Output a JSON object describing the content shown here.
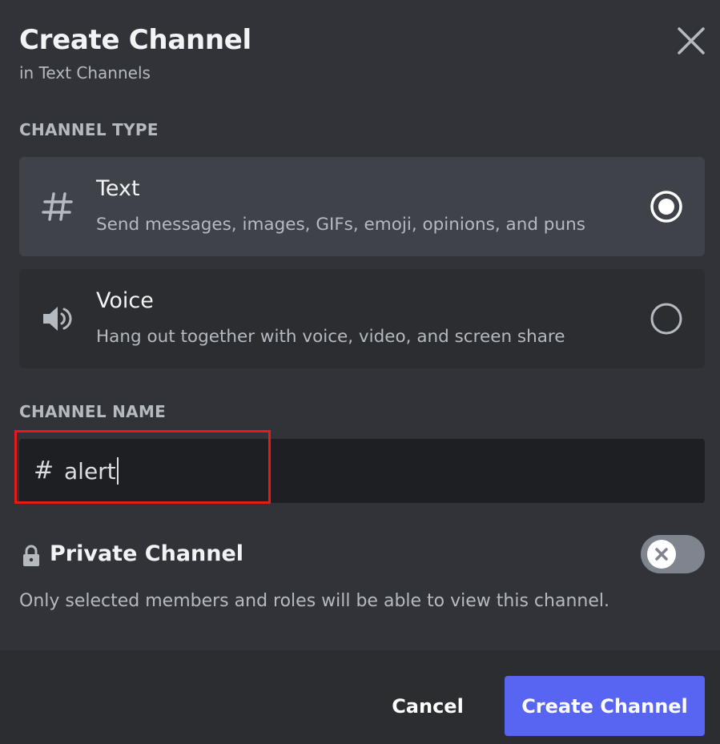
{
  "dialog": {
    "title": "Create Channel",
    "subtitle": "in Text Channels",
    "close_icon": "close-icon"
  },
  "channel_type": {
    "label": "CHANNEL TYPE",
    "options": [
      {
        "name": "Text",
        "description": "Send messages, images, GIFs, emoji, opinions, and puns",
        "icon": "hash-icon",
        "selected": true
      },
      {
        "name": "Voice",
        "description": "Hang out together with voice, video, and screen share",
        "icon": "speaker-icon",
        "selected": false
      }
    ]
  },
  "channel_name": {
    "label": "CHANNEL NAME",
    "prefix": "#",
    "value": "alert"
  },
  "private_channel": {
    "label": "Private Channel",
    "description": "Only selected members and roles will be able to view this channel.",
    "enabled": false,
    "icon": "lock-icon"
  },
  "footer": {
    "cancel_label": "Cancel",
    "create_label": "Create Channel"
  },
  "colors": {
    "background": "#313338",
    "option_selected": "#404249",
    "option_unselected": "#2b2d31",
    "input_background": "#1e1f22",
    "accent": "#5865f2",
    "highlight_border": "#e8191b"
  }
}
